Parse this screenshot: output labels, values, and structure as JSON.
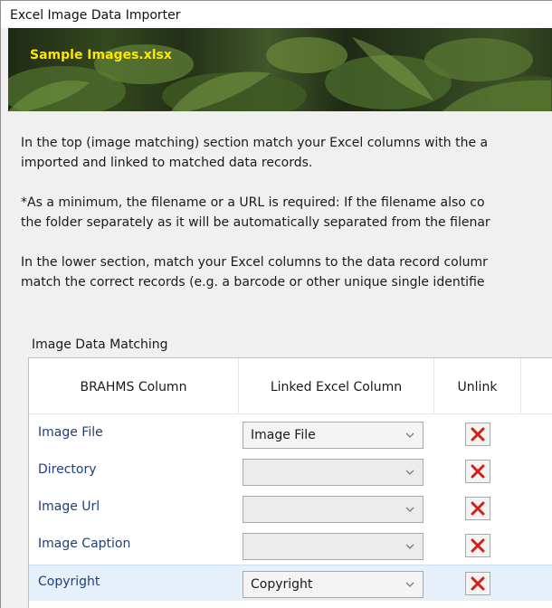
{
  "window": {
    "title": "Excel Image Data Importer"
  },
  "banner": {
    "filename": "Sample Images.xlsx"
  },
  "instructions": {
    "p1_line1": "In the top (image matching) section match your Excel columns with the a",
    "p1_line2": "imported and linked to matched data records.",
    "p2_line1": "*As a minimum, the filename or a URL is required: If the filename also co",
    "p2_line2": "the folder separately as it will be automatically separated from the filenar",
    "p3_line1": "In the lower section, match your Excel columns to the data record columr",
    "p3_line2": "match the correct records (e.g. a barcode or other unique single identifie"
  },
  "image_matching": {
    "label": "Image Data Matching",
    "headers": {
      "brahms_column": "BRAHMS Column",
      "linked_excel_column": "Linked Excel Column",
      "unlink": "Unlink"
    },
    "rows": [
      {
        "brahms_column": "Image File",
        "linked_excel_column": "Image File"
      },
      {
        "brahms_column": "Directory",
        "linked_excel_column": ""
      },
      {
        "brahms_column": "Image Url",
        "linked_excel_column": ""
      },
      {
        "brahms_column": "Image Caption",
        "linked_excel_column": ""
      },
      {
        "brahms_column": "Copyright",
        "linked_excel_column": "Copyright"
      }
    ],
    "selected_row": "Copyright"
  },
  "colors": {
    "accent_text": "#1f3f7a",
    "banner_text": "#ffe600",
    "unlink_x": "#d0201a",
    "selected_row": "#e6f0fb"
  },
  "icons": {
    "dropdown": "chevron-down-icon",
    "unlink": "red-x-icon"
  }
}
